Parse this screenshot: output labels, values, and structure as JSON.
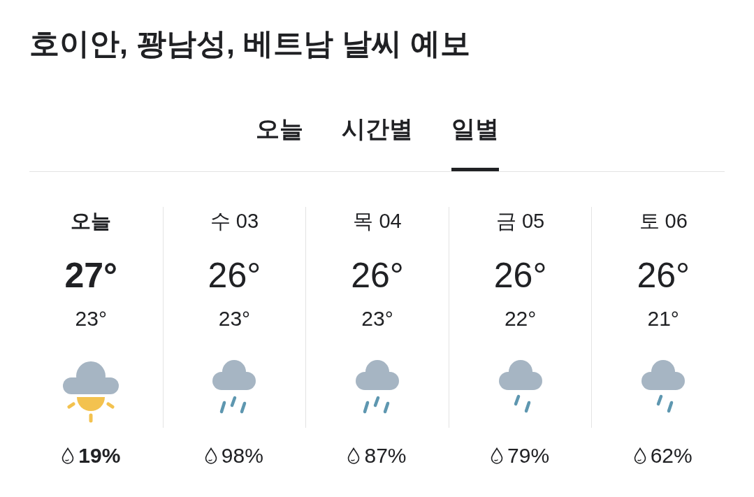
{
  "title": "호이안, 꽝남성, 베트남 날씨 예보",
  "tabs": [
    {
      "label": "오늘",
      "selected": false
    },
    {
      "label": "시간별",
      "selected": false
    },
    {
      "label": "일별",
      "selected": true
    }
  ],
  "days": [
    {
      "label": "오늘",
      "today": true,
      "high": "27°",
      "low": "23°",
      "kind": "cloud-sun",
      "precip": "19%"
    },
    {
      "label": "수 03",
      "today": false,
      "high": "26°",
      "low": "23°",
      "kind": "heavy-rain",
      "precip": "98%"
    },
    {
      "label": "목 04",
      "today": false,
      "high": "26°",
      "low": "23°",
      "kind": "heavy-rain",
      "precip": "87%"
    },
    {
      "label": "금 05",
      "today": false,
      "high": "26°",
      "low": "22°",
      "kind": "rain",
      "precip": "79%"
    },
    {
      "label": "토 06",
      "today": false,
      "high": "26°",
      "low": "21°",
      "kind": "rain",
      "precip": "62%"
    }
  ]
}
